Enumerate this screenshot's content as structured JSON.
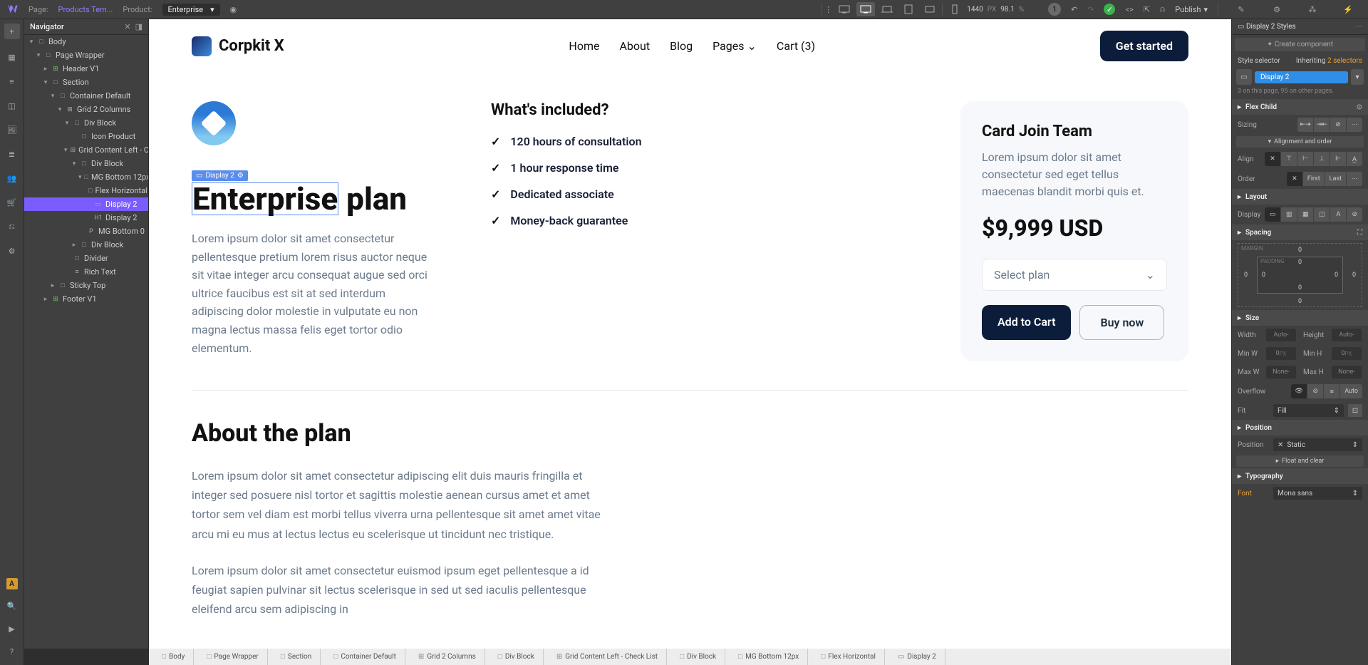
{
  "topbar": {
    "page_label": "Page:",
    "page_name": "Products Tem...",
    "product_label": "Product:",
    "product_name": "Enterprise",
    "width": "1440",
    "width_unit": "PX",
    "zoom": "98.1",
    "zoom_unit": "%",
    "badge": "1",
    "publish": "Publish"
  },
  "navigator": {
    "title": "Navigator",
    "rows": [
      {
        "indent": 0,
        "tw": "▾",
        "ty": "□",
        "label": "Body"
      },
      {
        "indent": 1,
        "tw": "▾",
        "ty": "□",
        "label": "Page Wrapper"
      },
      {
        "indent": 2,
        "tw": "▸",
        "ty": "⊞",
        "tycls": "green",
        "label": "Header V1"
      },
      {
        "indent": 2,
        "tw": "▾",
        "ty": "□",
        "label": "Section"
      },
      {
        "indent": 3,
        "tw": "▾",
        "ty": "□",
        "label": "Container Default"
      },
      {
        "indent": 4,
        "tw": "▾",
        "ty": "⊞",
        "label": "Grid 2 Columns"
      },
      {
        "indent": 5,
        "tw": "▾",
        "ty": "□",
        "label": "Div Block"
      },
      {
        "indent": 6,
        "tw": "",
        "ty": "□",
        "label": "Icon Product"
      },
      {
        "indent": 5,
        "tw": "▾",
        "ty": "⊞",
        "label": "Grid Content Left - Ch"
      },
      {
        "indent": 6,
        "tw": "▾",
        "ty": "□",
        "label": "Div Block"
      },
      {
        "indent": 7,
        "tw": "▾",
        "ty": "□",
        "label": "MG Bottom 12px"
      },
      {
        "indent": 8,
        "tw": "",
        "ty": "□",
        "label": "Flex Horizontal"
      },
      {
        "indent": 8,
        "tw": "",
        "ty": "▭",
        "label": "Display 2",
        "sel": true
      },
      {
        "indent": 8,
        "tw": "",
        "ty": "H1",
        "label": "Display 2"
      },
      {
        "indent": 7,
        "tw": "",
        "ty": "P",
        "label": "MG Bottom 0"
      },
      {
        "indent": 6,
        "tw": "▸",
        "ty": "□",
        "label": "Div Block"
      },
      {
        "indent": 5,
        "tw": "",
        "ty": "□",
        "label": "Divider"
      },
      {
        "indent": 5,
        "tw": "",
        "ty": "≡",
        "label": "Rich Text"
      },
      {
        "indent": 3,
        "tw": "▸",
        "ty": "□",
        "label": "Sticky Top"
      },
      {
        "indent": 2,
        "tw": "▸",
        "ty": "⊞",
        "tycls": "green",
        "label": "Footer V1"
      }
    ]
  },
  "site": {
    "brand": "Corpkit X",
    "nav": [
      "Home",
      "About",
      "Blog",
      "Pages",
      "Cart (3)"
    ],
    "cta": "Get started",
    "sel_label": "Display 2",
    "plan_first": "Enterprise",
    "plan_rest": " plan",
    "desc": "Lorem ipsum dolor sit amet consectetur pellentesque pretium lorem risus auctor neque sit vitae integer arcu consequat augue sed orci ultrice faucibus est sit at sed interdum adipiscing dolor molestie in vulputate eu non magna lectus massa felis eget tortor odio elementum.",
    "included_title": "What's included?",
    "included": [
      "120 hours of consultation",
      "1 hour response time",
      "Dedicated associate",
      "Money-back guarantee"
    ],
    "card_title": "Card Join Team",
    "card_desc": "Lorem ipsum dolor sit amet consectetur sed eget tellus maecenas blandit morbi quis et.",
    "price": "$9,999 USD",
    "select_plan": "Select plan",
    "add_cart": "Add to Cart",
    "buy_now": "Buy now",
    "about_title": "About the plan",
    "about_p1": "Lorem ipsum dolor sit amet consectetur adipiscing elit duis mauris fringilla et integer sed posuere nisl tortor et sagittis molestie aenean cursus amet et amet tortor sem vel diam est morbi tellus viverra urna pellentesque sit amet amet vitae arcu mi eu mus at lectus lectus eu scelerisque ut tincidunt nec tristique.",
    "about_p2": "Lorem ipsum dolor sit amet consectetur euismod ipsum eget pellentesque a id feugiat sapien pulvinar sit lectus scelerisque in sed ut sed iaculis pellentesque eleifend arcu sem adipiscing in"
  },
  "crumbs": [
    "Body",
    "Page Wrapper",
    "Section",
    "Container Default",
    "Grid 2 Columns",
    "Div Block",
    "Grid Content Left - Check List",
    "Div Block",
    "MG Bottom 12px",
    "Flex Horizontal",
    "Display 2"
  ],
  "right": {
    "head": "Display 2 Styles",
    "create": "Create component",
    "selector_label": "Style selector",
    "inheriting": "Inheriting",
    "inheriting_n": "2 selectors",
    "tag": "Display 2",
    "hint": "3 on this page, 95 on other pages.",
    "flex_child": "Flex Child",
    "sizing": "Sizing",
    "align_order": "Alignment and order",
    "align": "Align",
    "order": "Order",
    "first": "First",
    "last": "Last",
    "layout": "Layout",
    "display": "Display",
    "spacing": "Spacing",
    "margin": "MARGIN",
    "padding": "PADDING",
    "size": "Size",
    "width": "Width",
    "height": "Height",
    "minw": "Min W",
    "minh": "Min H",
    "maxw": "Max W",
    "maxh": "Max H",
    "auto": "Auto",
    "zero": "0",
    "px": "PX",
    "none": "None",
    "overflow": "Overflow",
    "fit": "Fit",
    "fill": "Fill",
    "position": "Position",
    "static": "Static",
    "float_clear": "Float and clear",
    "typography": "Typography",
    "font": "Font",
    "mona": "Mona sans"
  }
}
